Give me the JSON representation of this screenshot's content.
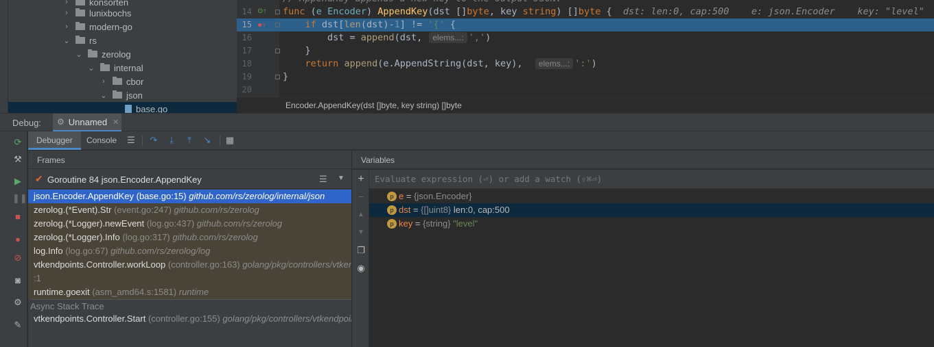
{
  "project_tree": {
    "items": [
      {
        "label": "konsorten",
        "chevron": "›",
        "kind": "folder"
      },
      {
        "label": "lunixbochs",
        "chevron": "›",
        "kind": "folder"
      },
      {
        "label": "modern-go",
        "chevron": "›",
        "kind": "folder"
      },
      {
        "label": "rs",
        "chevron": "⌄",
        "kind": "folder"
      },
      {
        "label": "zerolog",
        "chevron": "⌄",
        "kind": "folder"
      },
      {
        "label": "internal",
        "chevron": "⌄",
        "kind": "folder"
      },
      {
        "label": "cbor",
        "chevron": "›",
        "kind": "folder"
      },
      {
        "label": "json",
        "chevron": "⌄",
        "kind": "folder"
      },
      {
        "label": "base.go",
        "chevron": "",
        "kind": "file"
      }
    ]
  },
  "editor": {
    "lines": [
      {
        "num": "14"
      },
      {
        "num": "15"
      },
      {
        "num": "16"
      },
      {
        "num": "17"
      },
      {
        "num": "18"
      },
      {
        "num": "19"
      },
      {
        "num": "20"
      }
    ],
    "top_comment": "// AppendKey appends a new key to the output JSON.",
    "inline_values": {
      "dst": "dst: len:0, cap:500",
      "e": "e: json.Encoder",
      "key": "key: \"level\""
    },
    "inlay_hint": "elems...:",
    "breadcrumb": "Encoder.AppendKey(dst []byte, key string) []byte"
  },
  "debug": {
    "window_title": "Debug:",
    "session_tab": "Unnamed",
    "tabs": [
      "Debugger",
      "Console"
    ],
    "frames_title": "Frames",
    "variables_title": "Variables",
    "thread": "Goroutine 84 json.Encoder.AppendKey",
    "frames": [
      {
        "method": "json.Encoder.AppendKey",
        "loc": "(base.go:15)",
        "pkg": "github.com/rs/zerolog/internal/json"
      },
      {
        "method": "zerolog.(*Event).Str",
        "loc": "(event.go:247)",
        "pkg": "github.com/rs/zerolog"
      },
      {
        "method": "zerolog.(*Logger).newEvent",
        "loc": "(log.go:437)",
        "pkg": "github.com/rs/zerolog"
      },
      {
        "method": "zerolog.(*Logger).Info",
        "loc": "(log.go:317)",
        "pkg": "github.com/rs/zerolog"
      },
      {
        "method": "log.Info",
        "loc": "(log.go:67)",
        "pkg": "github.com/rs/zerolog/log"
      },
      {
        "method": "vtkendpoints.Controller.workLoop",
        "loc": "(controller.go:163)",
        "pkg": "golang/pkg/controllers/vtkendpoints"
      },
      {
        "method": "",
        "loc": ":1",
        "pkg": ""
      },
      {
        "method": "runtime.goexit",
        "loc": "(asm_amd64.s:1581)",
        "pkg": "runtime"
      }
    ],
    "async_label": "Async Stack Trace",
    "async_frames": [
      {
        "method": "vtkendpoints.Controller.Start",
        "loc": "(controller.go:155)",
        "pkg": "golang/pkg/controllers/vtkendpoints"
      }
    ],
    "eval_placeholder": "Evaluate expression (⏎) or add a watch (⇧⌘⏎)",
    "variables": [
      {
        "badge": "p",
        "name": "e",
        "type": "{json.Encoder}",
        "value": ""
      },
      {
        "badge": "p",
        "name": "dst",
        "type": "{[]uint8}",
        "value": "len:0, cap:500"
      },
      {
        "badge": "p",
        "name": "key",
        "type": "{string}",
        "value": "\"level\""
      }
    ]
  },
  "colors": {
    "accent": "#4a88c7",
    "selection": "#2f65ca",
    "highlight_line": "#2d5f8b",
    "breakpoint": "#c75450"
  }
}
